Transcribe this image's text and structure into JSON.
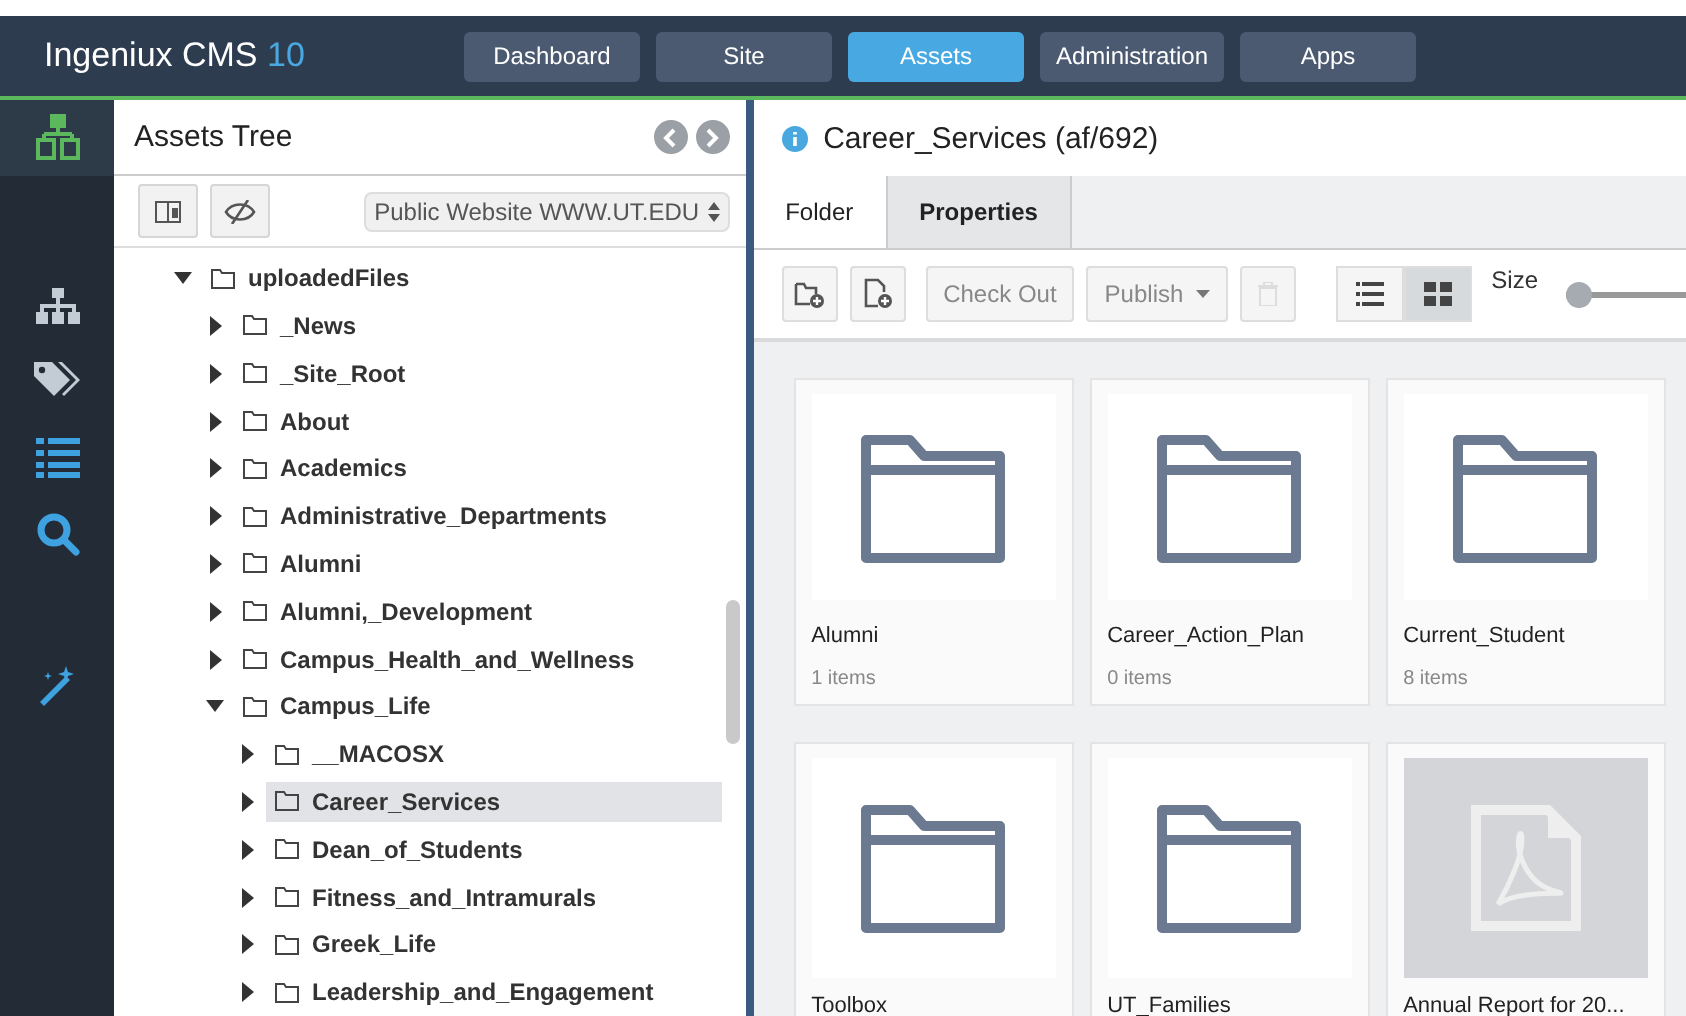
{
  "header": {
    "product": "Ingeniux CMS",
    "version": "10"
  },
  "nav": [
    {
      "label": "Dashboard",
      "selected": false
    },
    {
      "label": "Site",
      "selected": false
    },
    {
      "label": "Assets",
      "selected": true
    },
    {
      "label": "Administration",
      "selected": false
    },
    {
      "label": "Apps",
      "selected": false
    }
  ],
  "sidebar": [
    {
      "kind": "tree",
      "selected": true
    },
    {
      "kind": "sitemap",
      "selected": false
    },
    {
      "kind": "tags",
      "selected": false
    },
    {
      "kind": "list",
      "selected": false
    },
    {
      "kind": "search",
      "selected": false
    },
    {
      "kind": "wand",
      "selected": false
    }
  ],
  "tree_panel": {
    "title": "Assets Tree",
    "site_select": "Public Website WWW.UT.EDU",
    "tree": [
      {
        "label": "uploadedFiles",
        "expanded": true,
        "selected": false,
        "children": [
          {
            "label": "_News",
            "expanded": false,
            "selected": false
          },
          {
            "label": "_Site_Root",
            "expanded": false,
            "selected": false
          },
          {
            "label": "About",
            "expanded": false,
            "selected": false
          },
          {
            "label": "Academics",
            "expanded": false,
            "selected": false
          },
          {
            "label": "Administrative_Departments",
            "expanded": false,
            "selected": false
          },
          {
            "label": "Alumni",
            "expanded": false,
            "selected": false
          },
          {
            "label": "Alumni,_Development",
            "expanded": false,
            "selected": false
          },
          {
            "label": "Campus_Health_and_Wellness",
            "expanded": false,
            "selected": false
          },
          {
            "label": "Campus_Life",
            "expanded": true,
            "selected": false,
            "children": [
              {
                "label": "__MACOSX",
                "expanded": false,
                "selected": false
              },
              {
                "label": "Career_Services",
                "expanded": false,
                "selected": true
              },
              {
                "label": "Dean_of_Students",
                "expanded": false,
                "selected": false
              },
              {
                "label": "Fitness_and_Intramurals",
                "expanded": false,
                "selected": false
              },
              {
                "label": "Greek_Life",
                "expanded": false,
                "selected": false
              },
              {
                "label": "Leadership_and_Engagement",
                "expanded": false,
                "selected": false
              }
            ]
          }
        ]
      }
    ]
  },
  "detail": {
    "title": "Career_Services (af/692)",
    "tabs": [
      {
        "label": "Folder",
        "selected": true
      },
      {
        "label": "Properties",
        "selected": false
      }
    ],
    "toolbar": {
      "check_out": "Check Out",
      "publish": "Publish",
      "views": [
        {
          "kind": "list",
          "selected": false
        },
        {
          "kind": "grid",
          "selected": true
        }
      ],
      "size_label": "Size",
      "size": {
        "level": 0
      }
    },
    "items": [
      {
        "kind": "folder",
        "name": "Alumni",
        "count": "1 items"
      },
      {
        "kind": "folder",
        "name": "Career_Action_Plan",
        "count": "0 items"
      },
      {
        "kind": "folder",
        "name": "Current_Student",
        "count": "8 items"
      },
      {
        "kind": "folder",
        "name": "Toolbox"
      },
      {
        "kind": "folder",
        "name": "UT_Families"
      },
      {
        "kind": "pdf",
        "name": "Annual Report for 20..."
      }
    ]
  }
}
